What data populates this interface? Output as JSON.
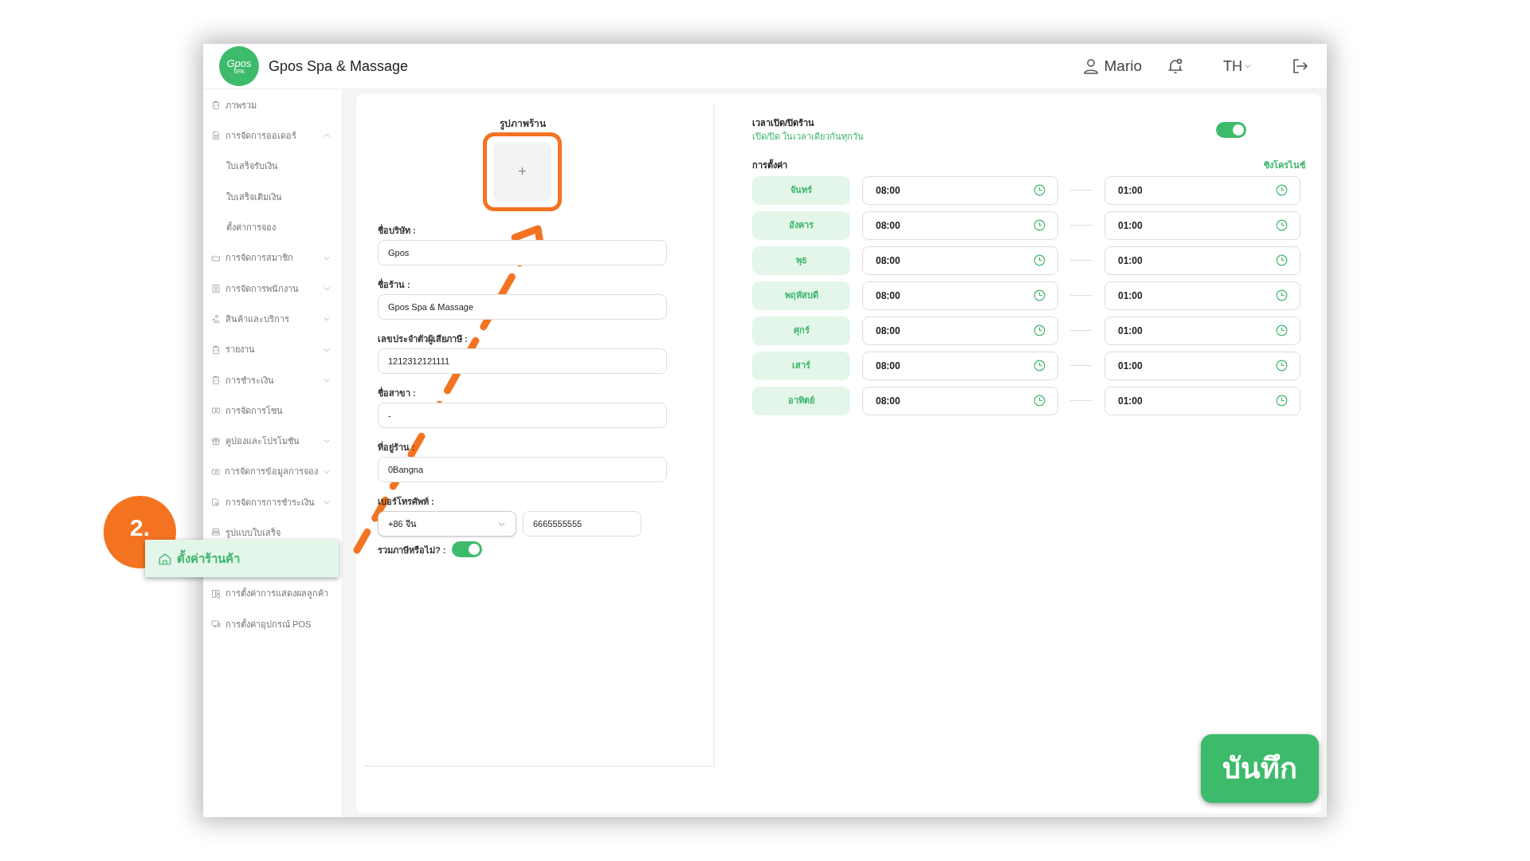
{
  "header": {
    "logo": {
      "text": "Gpos",
      "sub": "SPA"
    },
    "brand": "Gpos Spa & Massage",
    "user": "Mario",
    "language": "TH"
  },
  "sidebar": {
    "items": [
      {
        "label": "ภาพรวม",
        "selected": false
      },
      {
        "label": "การจัดการออเดอร์",
        "selected": false,
        "expanded": true,
        "children": [
          {
            "label": "ใบเสร็จรับเงิน"
          },
          {
            "label": "ใบเสร็จเติมเงิน"
          },
          {
            "label": "ตั้งค่าการจอง"
          }
        ]
      },
      {
        "label": "การจัดการสมาชิก",
        "selected": false,
        "expanded": false
      },
      {
        "label": "การจัดการพนักงาน",
        "selected": false,
        "expanded": false
      },
      {
        "label": "สินค้าและบริการ",
        "selected": false,
        "expanded": false
      },
      {
        "label": "รายงาน",
        "selected": false,
        "expanded": false
      },
      {
        "label": "การชำระเงิน",
        "selected": false,
        "expanded": false
      },
      {
        "label": "การจัดการโซน",
        "selected": false
      },
      {
        "label": "คูปองและโปรโมชัน",
        "selected": false,
        "expanded": false
      },
      {
        "label": "การจัดการข้อมูลการจอง",
        "selected": false,
        "expanded": false
      },
      {
        "label": "การจัดการการชำระเงิน",
        "selected": false,
        "expanded": false
      },
      {
        "label": "รูปแบบใบเสร็จ",
        "selected": false
      },
      {
        "label": "ตั้งค่าร้านค้า",
        "selected": true
      },
      {
        "label": "การตั้งค่าการแสดงผลลูกค้า",
        "selected": false
      },
      {
        "label": "การตั้งค่าอุปกรณ์ POS",
        "selected": false
      }
    ]
  },
  "store_form": {
    "image_label": "รูปภาพร้าน",
    "image_button": "+",
    "fields": [
      {
        "label": "ชื่อบริษัท :",
        "value": "Gpos"
      },
      {
        "label": "ชื่อร้าน :",
        "value": "Gpos Spa & Massage"
      },
      {
        "label": "เลขประจำตัวผู้เสียภาษี :",
        "value": "1212312121111"
      },
      {
        "label": "ชื่อสาขา :",
        "value": "-"
      },
      {
        "label": "ที่อยู่ร้าน :",
        "value": "0Bangna"
      }
    ],
    "phone": {
      "label": "เบอร์โทรศัพท์ :",
      "country": "+86 จีน",
      "value": "6665555555"
    },
    "tax": {
      "label": "รวมภาษีหรือไม่? :",
      "on": true
    }
  },
  "hours": {
    "title": "เวลาเปิด/ปิดร้าน",
    "subtitle": "เปิด/ปิด ในเวลาเดียวกันทุกวัน",
    "same_every_day": true,
    "settings_label": "การตั้งค่า",
    "sync_link": "ซิงโครไนซ์",
    "days": [
      {
        "day": "จันทร์",
        "open": "08:00",
        "close": "01:00"
      },
      {
        "day": "อังคาร",
        "open": "08:00",
        "close": "01:00"
      },
      {
        "day": "พุธ",
        "open": "08:00",
        "close": "01:00"
      },
      {
        "day": "พฤหัสบดี",
        "open": "08:00",
        "close": "01:00"
      },
      {
        "day": "ศุกร์",
        "open": "08:00",
        "close": "01:00"
      },
      {
        "day": "เสาร์",
        "open": "08:00",
        "close": "01:00"
      },
      {
        "day": "อาทิตย์",
        "open": "08:00",
        "close": "01:00"
      }
    ]
  },
  "save_button": "บันทึก",
  "annotation": {
    "step": "2.",
    "highlight_image": true,
    "arrow": true
  }
}
